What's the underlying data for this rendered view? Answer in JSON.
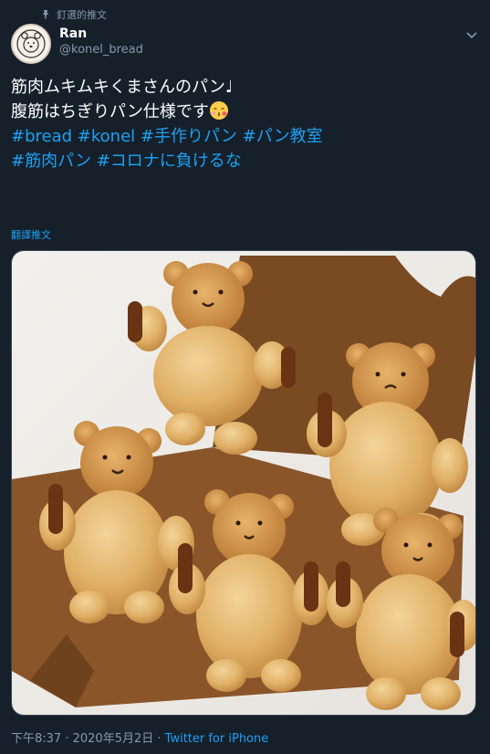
{
  "pinned": {
    "label": "釘選的推文"
  },
  "author": {
    "display_name": "Ran",
    "handle": "@konel_bread"
  },
  "tweet": {
    "line1": "筋肉ムキムキくまさんのパン♩",
    "line2": "腹筋はちぎりパン仕様です",
    "hashtags_row1": [
      "#bread",
      "#konel",
      "#手作りパン",
      "#パン教室"
    ],
    "hashtags_row2": [
      "#筋肉パン",
      "#コロナに負けるな"
    ],
    "emoji": "kissing-face-with-closed-eyes"
  },
  "translate_label": "翻譯推文",
  "meta": {
    "time": "下午8:37",
    "separator": " · ",
    "date": "2020年5月2日",
    "source": "Twitter for iPhone"
  },
  "icons": {
    "pin": "pin-icon",
    "caret": "chevron-down-icon",
    "avatar": "bear-logo"
  },
  "colors": {
    "background": "#15202b",
    "link": "#1da1f2",
    "secondary": "#8899a6"
  }
}
